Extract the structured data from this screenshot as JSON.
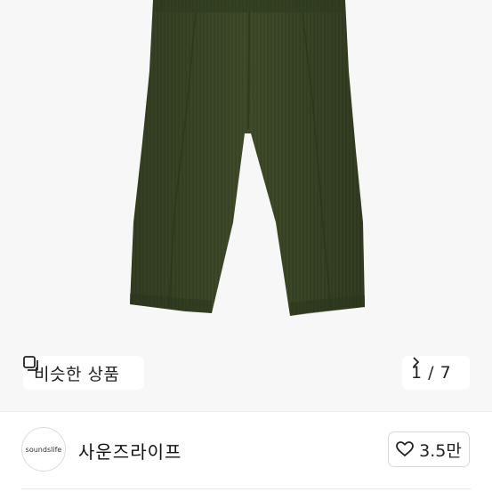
{
  "photo": {
    "description_icon": "trousers-photo",
    "colors": {
      "fabric": "#3e4a2a",
      "fabric_dark": "#2a331b",
      "background": "#f7f7f7"
    }
  },
  "similar": {
    "icon": "similar-items-icon",
    "label": "비슷한 상품"
  },
  "counter": {
    "current": 1,
    "total": 7,
    "text": "1 / 7",
    "icon": "chevron-right-icon"
  },
  "seller": {
    "avatar_text": "soundslife",
    "name": "사운즈라이프"
  },
  "like": {
    "icon": "heart-outline-icon",
    "count": "3.5만"
  }
}
